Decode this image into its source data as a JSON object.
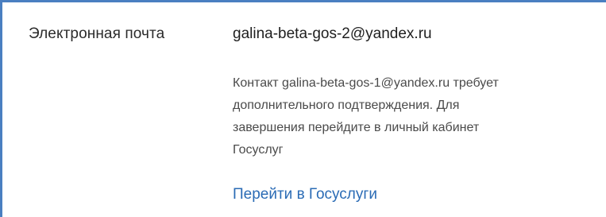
{
  "field": {
    "label": "Электронная почта",
    "value": "galina-beta-gos-2@yandex.ru"
  },
  "notice": {
    "lines": [
      "Контакт galina-beta-gos-1@yandex.ru требует",
      "дополнительного подтверждения. Для",
      "завершения перейдите в личный кабинет",
      "Госуслуг"
    ]
  },
  "action": {
    "link_label": "Перейти в Госуслуги"
  },
  "colors": {
    "accent_border": "#4a7fc1",
    "link": "#2a6bb5"
  }
}
